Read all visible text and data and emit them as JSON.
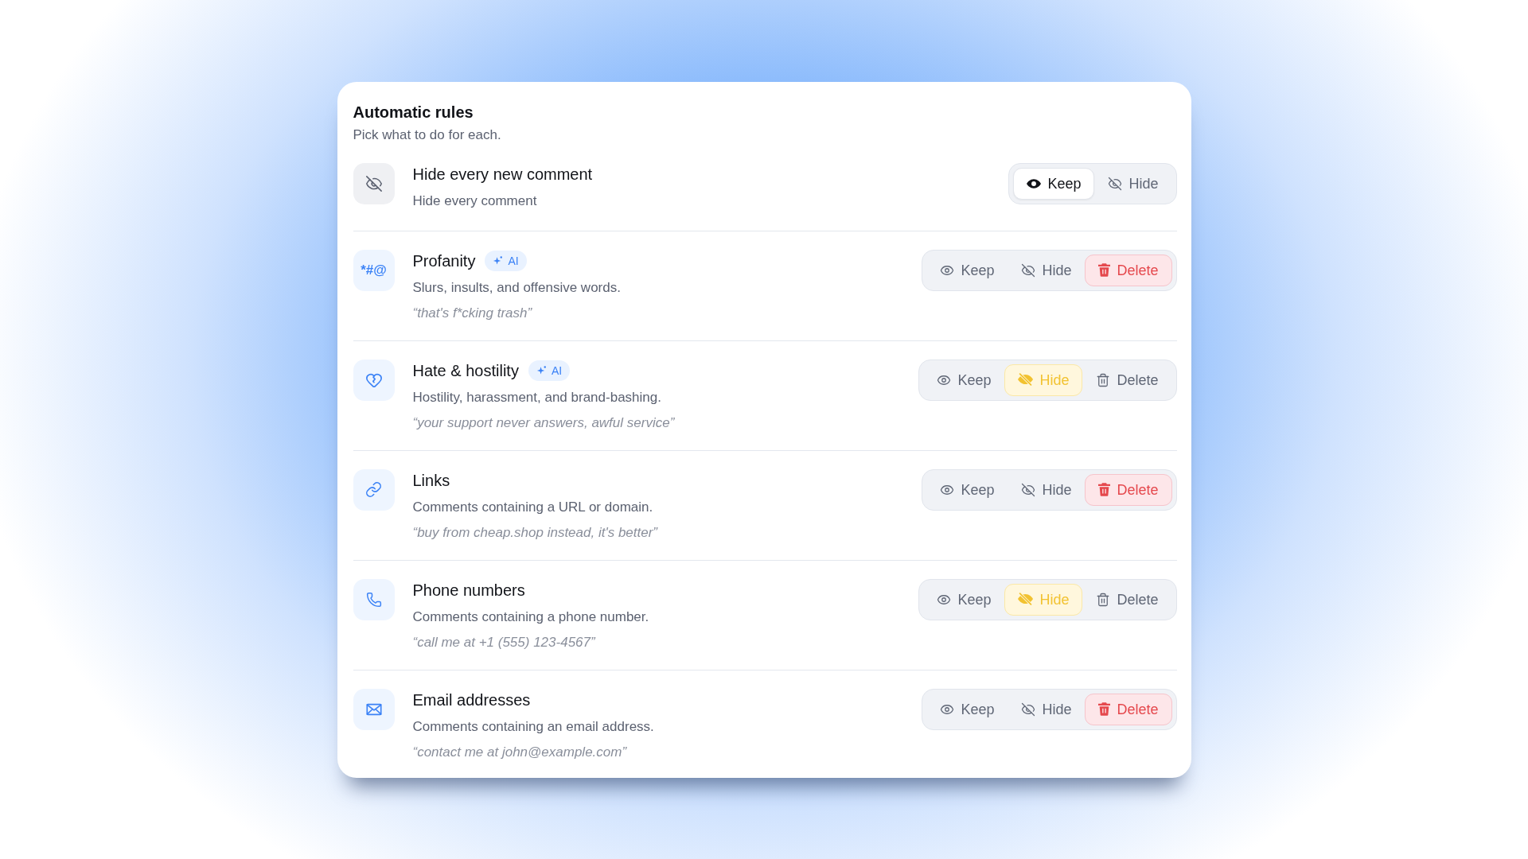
{
  "card": {
    "title": "Automatic rules",
    "subtitle": "Pick what to do for each."
  },
  "rules": [
    {
      "kind": "all",
      "title": "Hide every new comment",
      "description": "Hide every comment",
      "options": [
        {
          "kind": "keep",
          "label": "Keep",
          "selected": true
        },
        {
          "kind": "hide",
          "label": "Hide",
          "selected": false
        }
      ]
    },
    {
      "kind": "profanity",
      "glyph": "*#@",
      "title": "Profanity",
      "badge": "AI",
      "description": "Slurs, insults, and offensive words.",
      "example": "“that's f*cking trash”",
      "options": [
        {
          "kind": "keep",
          "label": "Keep",
          "selected": false
        },
        {
          "kind": "hide",
          "label": "Hide",
          "selected": false
        },
        {
          "kind": "delete",
          "label": "Delete",
          "selected": true
        }
      ]
    },
    {
      "kind": "hate",
      "title": "Hate & hostility",
      "badge": "AI",
      "description": "Hostility, harassment, and brand-bashing.",
      "example": "“your support never answers, awful service”",
      "options": [
        {
          "kind": "keep",
          "label": "Keep",
          "selected": false
        },
        {
          "kind": "hide",
          "label": "Hide",
          "selected": true
        },
        {
          "kind": "delete",
          "label": "Delete",
          "selected": false
        }
      ]
    },
    {
      "kind": "links",
      "title": "Links",
      "description": "Comments containing a URL or domain.",
      "example": "“buy from cheap.shop instead, it's better”",
      "options": [
        {
          "kind": "keep",
          "label": "Keep",
          "selected": false
        },
        {
          "kind": "hide",
          "label": "Hide",
          "selected": false
        },
        {
          "kind": "delete",
          "label": "Delete",
          "selected": true
        }
      ]
    },
    {
      "kind": "phone",
      "title": "Phone numbers",
      "description": "Comments containing a phone number.",
      "example": "“call me at +1 (555) 123-4567”",
      "options": [
        {
          "kind": "keep",
          "label": "Keep",
          "selected": false
        },
        {
          "kind": "hide",
          "label": "Hide",
          "selected": true
        },
        {
          "kind": "delete",
          "label": "Delete",
          "selected": false
        }
      ]
    },
    {
      "kind": "email",
      "title": "Email addresses",
      "description": "Comments containing an email address.",
      "example": "“contact me at john@example.com”",
      "options": [
        {
          "kind": "keep",
          "label": "Keep",
          "selected": false
        },
        {
          "kind": "hide",
          "label": "Hide",
          "selected": false
        },
        {
          "kind": "delete",
          "label": "Delete",
          "selected": true
        }
      ]
    }
  ]
}
